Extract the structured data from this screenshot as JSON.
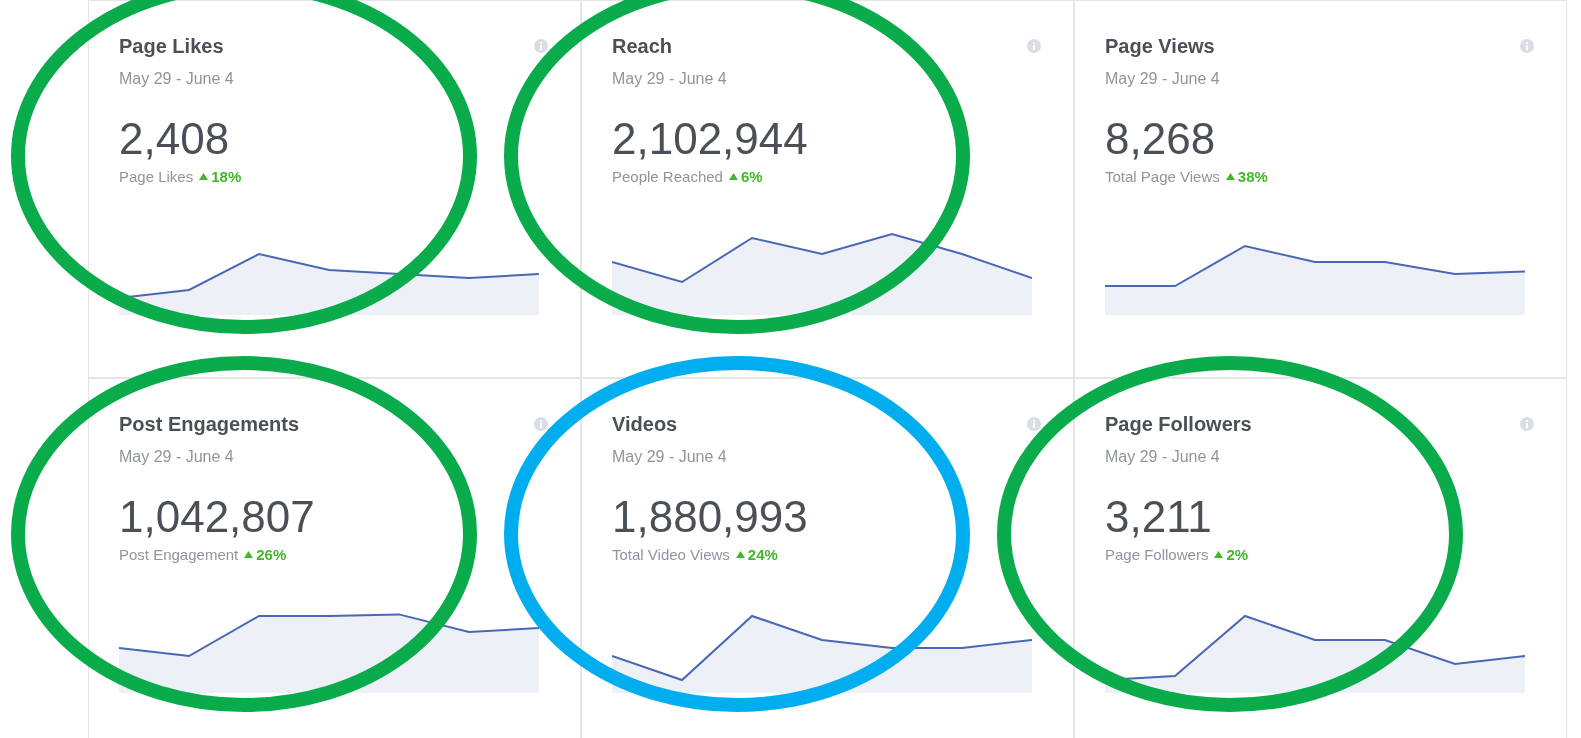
{
  "cards": [
    {
      "title": "Page Likes",
      "date": "May 29 - June 4",
      "value": "2,408",
      "caption": "Page Likes",
      "change": "18%",
      "color": "#0aab4a"
    },
    {
      "title": "Reach",
      "date": "May 29 - June 4",
      "value": "2,102,944",
      "caption": "People Reached",
      "change": "6%",
      "color": "#0aab4a"
    },
    {
      "title": "Page Views",
      "date": "May 29 - June 4",
      "value": "8,268",
      "caption": "Total Page Views",
      "change": "38%"
    },
    {
      "title": "Post Engagements",
      "date": "May 29 - June 4",
      "value": "1,042,807",
      "caption": "Post Engagement",
      "change": "26%",
      "color": "#0aab4a"
    },
    {
      "title": "Videos",
      "date": "May 29 - June 4",
      "value": "1,880,993",
      "caption": "Total Video Views",
      "change": "24%",
      "color": "#00aeef"
    },
    {
      "title": "Page Followers",
      "date": "May 29 - June 4",
      "value": "3,211",
      "caption": "Page Followers",
      "change": "2%",
      "color": "#0aab4a"
    }
  ]
}
